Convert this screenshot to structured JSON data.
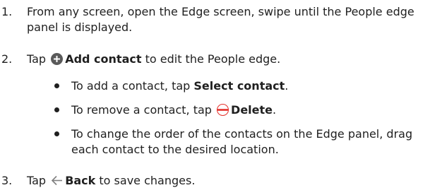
{
  "steps": [
    {
      "number": "1.",
      "text": "From any screen, open the Edge screen, swipe until the People edge panel is displayed."
    },
    {
      "number": "2.",
      "prefix": "Tap",
      "icon": "add-circle-icon",
      "bold": "Add contact",
      "suffix": "to edit the People edge."
    },
    {
      "number": "3.",
      "prefix": "Tap",
      "icon": "back-arrow-icon",
      "bold": "Back",
      "suffix": "to save changes."
    }
  ],
  "bullets": [
    {
      "prefix": "To add a contact, tap",
      "bold": "Select contact",
      "suffix": "."
    },
    {
      "prefix": "To remove a contact, tap",
      "icon": "remove-circle-icon",
      "bold": "Delete",
      "suffix": "."
    },
    {
      "text": "To change the order of the contacts on the Edge panel, drag each contact to the desired location."
    }
  ],
  "colors": {
    "text": "#1f1f1f",
    "add_icon": "#5a5a5a",
    "remove_icon": "#e4302b",
    "back_icon": "#808080"
  }
}
